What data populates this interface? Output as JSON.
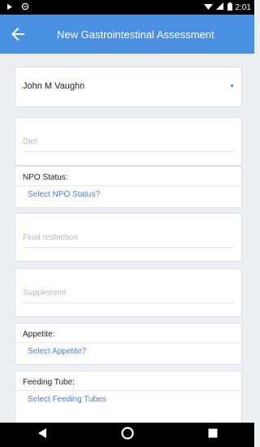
{
  "status_bar": {
    "time": "2:01",
    "icons": [
      "play-icon",
      "sync-icon",
      "wifi-icon",
      "signal-icon",
      "battery-icon"
    ]
  },
  "app_bar": {
    "title": "New Gastrointestinal Assessment",
    "back_icon": "arrow-left-icon",
    "color": "#4a90e2"
  },
  "patient": {
    "name": "John M Vaughn",
    "dropdown_icon": "caret-down-icon"
  },
  "fields": {
    "diet": {
      "placeholder": "Diet"
    },
    "npo_status": {
      "label": "NPO Status:",
      "value": "Select NPO Status?"
    },
    "fluid_restriction": {
      "placeholder": "Fluid restriction"
    },
    "supplement": {
      "placeholder": "Supplement"
    },
    "appetite": {
      "label": "Appetite:",
      "value": "Select Appetite?"
    },
    "feeding_tube": {
      "label": "Feeding Tube:",
      "value": "Select Feeding Tubes"
    }
  },
  "nav_bar": {
    "icons": [
      "back-triangle-icon",
      "home-circle-icon",
      "recents-square-icon"
    ]
  }
}
